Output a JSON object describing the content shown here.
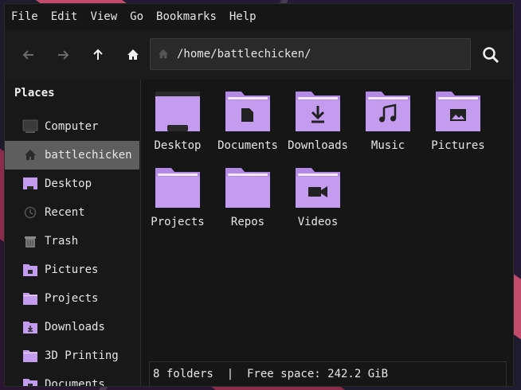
{
  "menubar": {
    "items": [
      "File",
      "Edit",
      "View",
      "Go",
      "Bookmarks",
      "Help"
    ]
  },
  "toolbar": {
    "back_icon": "arrow-left-icon",
    "forward_icon": "arrow-right-icon",
    "up_icon": "arrow-up-icon",
    "home_icon": "home-icon",
    "path": "/home/battlechicken/",
    "search_icon": "search-icon"
  },
  "sidebar": {
    "title": "Places",
    "items": [
      {
        "label": "Computer",
        "icon": "computer-icon"
      },
      {
        "label": "battlechicken",
        "icon": "home-icon",
        "active": true
      },
      {
        "label": "Desktop",
        "icon": "desktop-icon"
      },
      {
        "label": "Recent",
        "icon": "clock-icon"
      },
      {
        "label": "Trash",
        "icon": "trash-icon"
      },
      {
        "label": "Pictures",
        "icon": "folder-pictures-icon"
      },
      {
        "label": "Projects",
        "icon": "folder-icon"
      },
      {
        "label": "Downloads",
        "icon": "folder-downloads-icon"
      },
      {
        "label": "3D Printing",
        "icon": "folder-icon"
      },
      {
        "label": "Documents",
        "icon": "folder-documents-icon"
      }
    ]
  },
  "files": [
    {
      "name": "Desktop",
      "icon": "folder-desktop-icon"
    },
    {
      "name": "Documents",
      "icon": "folder-documents-icon"
    },
    {
      "name": "Downloads",
      "icon": "folder-downloads-icon"
    },
    {
      "name": "Music",
      "icon": "folder-music-icon"
    },
    {
      "name": "Pictures",
      "icon": "folder-pictures-icon"
    },
    {
      "name": "Projects",
      "icon": "folder-icon"
    },
    {
      "name": "Repos",
      "icon": "folder-icon"
    },
    {
      "name": "Videos",
      "icon": "folder-videos-icon"
    }
  ],
  "status": {
    "text": "8 folders  |  Free space: 242.2 GiB"
  },
  "colors": {
    "folder": "#c39cf0",
    "folder_tab": "#b48ae6",
    "active_bg": "#5e5e5e",
    "window_bg": "#161616"
  }
}
